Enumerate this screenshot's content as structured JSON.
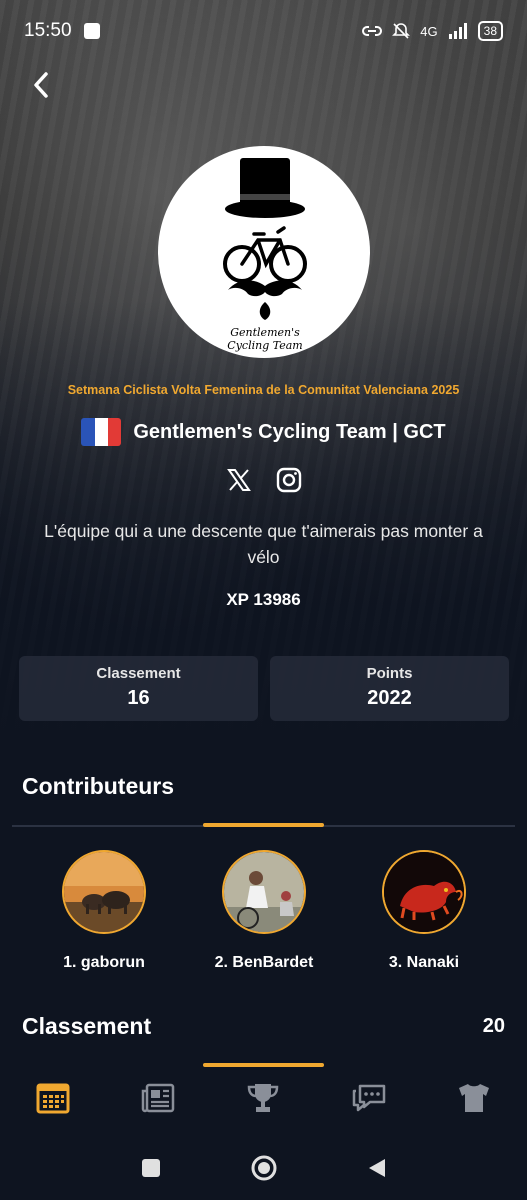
{
  "status_bar": {
    "time": "15:50",
    "network": "4G",
    "battery": "38",
    "icons": [
      "link-icon",
      "mute-bell-icon",
      "signal-icon",
      "battery-icon"
    ]
  },
  "header": {
    "back_icon": "chevron-left-icon"
  },
  "team": {
    "logo_text_line1": "Gentlemen's",
    "logo_text_line2": "Cycling Team",
    "race_name": "Setmana Ciclista Volta Femenina de la Comunitat Valenciana 2025",
    "name": "Gentlemen's Cycling Team | GCT",
    "flag": "france-flag",
    "flag_colors": [
      "#2a54b8",
      "#ffffff",
      "#e23a36"
    ],
    "social_links": [
      "x-icon",
      "instagram-icon"
    ],
    "motto": "L'équipe qui a une descente que t'aimerais pas monter a vélo",
    "xp": "XP 13986"
  },
  "stats": [
    {
      "label": "Classement",
      "value": "16"
    },
    {
      "label": "Points",
      "value": "2022"
    }
  ],
  "contributors": {
    "title": "Contributeurs",
    "items": [
      {
        "name": "1. gaborun",
        "avatar": "elephants-avatar"
      },
      {
        "name": "2. BenBardet",
        "avatar": "cyclists-avatar"
      },
      {
        "name": "3. Nanaki",
        "avatar": "red-beast-avatar"
      }
    ]
  },
  "ranking": {
    "title": "Classement",
    "count": "20"
  },
  "bottom_nav": [
    {
      "icon": "calendar-icon",
      "active": true
    },
    {
      "icon": "news-icon",
      "active": false
    },
    {
      "icon": "trophy-icon",
      "active": false
    },
    {
      "icon": "chat-icon",
      "active": false
    },
    {
      "icon": "jersey-icon",
      "active": false
    }
  ],
  "colors": {
    "accent": "#f0a830",
    "background": "#0e1420",
    "card": "#282e3c",
    "inactive_icon": "#8a8f99"
  }
}
